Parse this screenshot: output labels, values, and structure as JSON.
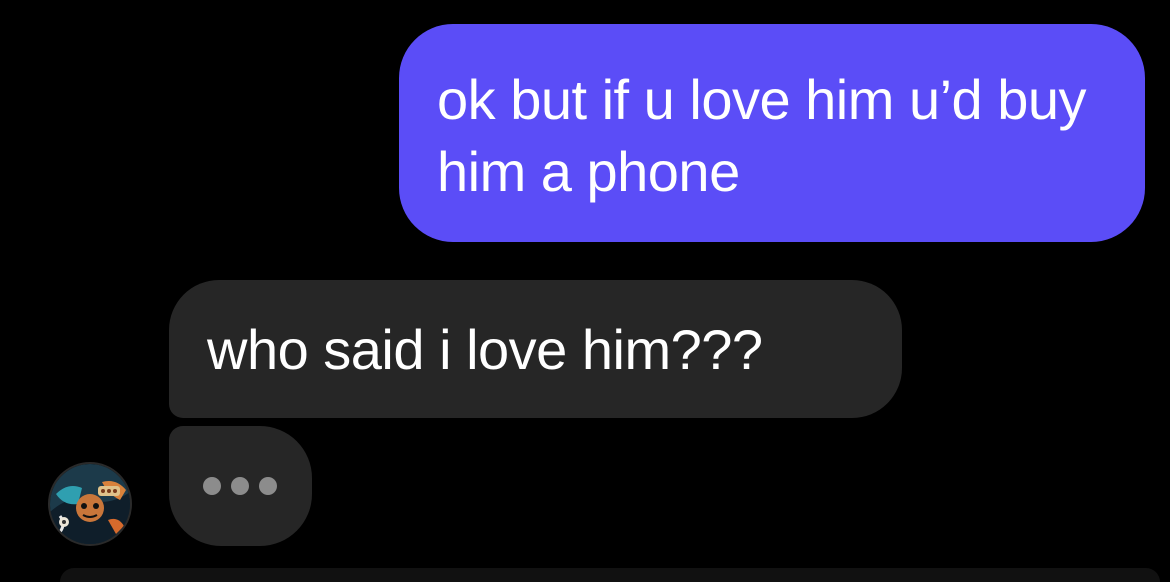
{
  "conversation": {
    "messages": [
      {
        "direction": "outgoing",
        "text": "ok but if u love him u’d buy him a phone"
      },
      {
        "direction": "incoming",
        "text": "who said i love him???"
      }
    ],
    "typing_indicator": {
      "visible": true,
      "icon": "typing-dots-icon"
    },
    "contact_avatar": {
      "icon": "contact-avatar-illustration"
    }
  },
  "colors": {
    "background": "#000000",
    "outgoing_bubble": "#5b4df7",
    "incoming_bubble": "#262626",
    "typing_dots": "#8c8c8c",
    "text": "#ffffff"
  }
}
